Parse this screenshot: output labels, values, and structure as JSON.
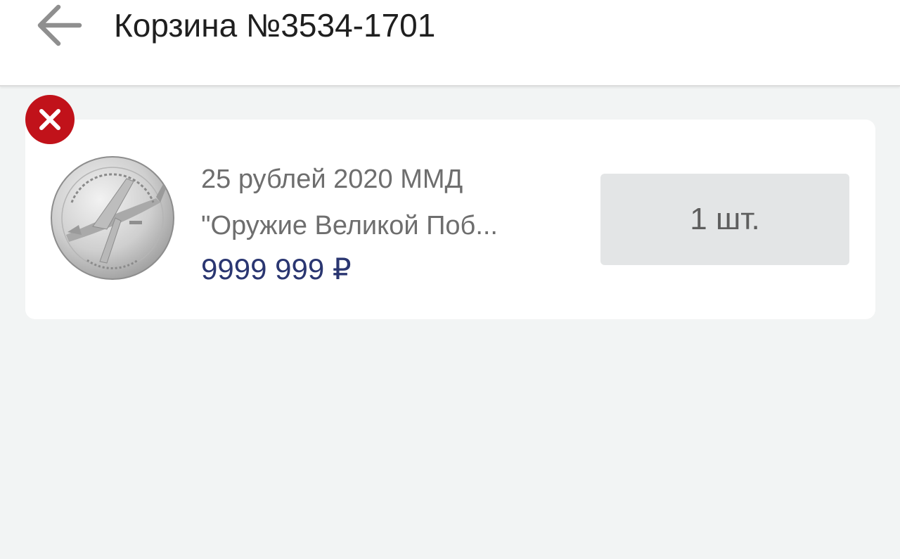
{
  "header": {
    "title": "Корзина №3534-1701",
    "back_icon": "arrow-left-icon"
  },
  "cart": {
    "items": [
      {
        "name_line1": "25 рублей 2020 ММД",
        "name_line2": "\"Оружие Великой Поб...",
        "price": "9999 999 ₽",
        "quantity": "1 шт.",
        "remove_icon": "close-icon",
        "image_icon": "coin-image"
      }
    ]
  },
  "colors": {
    "background": "#f2f4f4",
    "card": "#ffffff",
    "remove": "#c1121a",
    "price": "#2a3671",
    "quantity_button": "#e3e5e6"
  }
}
